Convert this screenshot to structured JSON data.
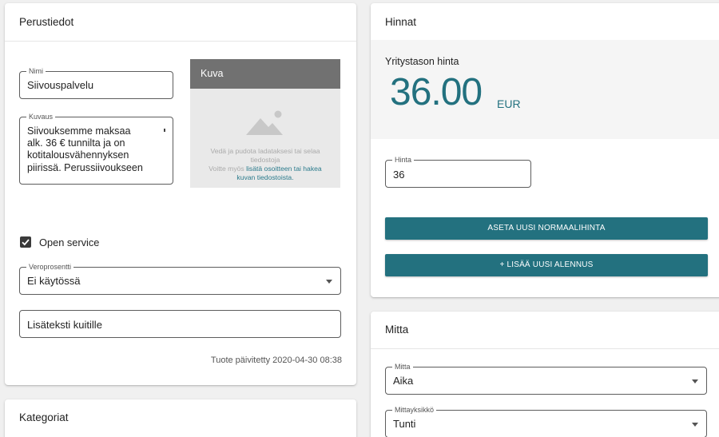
{
  "perustiedot": {
    "title": "Perustiedot",
    "name_legend": "Nimi",
    "name_value": "Siivouspalvelu",
    "description_legend": "Kuvaus",
    "description_lines": [
      "Siivouksemme maksaa",
      "alk. 36 € tunnilta ja on",
      "kotitalousvähennyksen",
      "piirissä. Perussiivoukseen"
    ],
    "image": {
      "title": "Kuva",
      "icon": "image-placeholder-icon",
      "hint_line1": "Vedä ja pudota ladataksesi tai selaa",
      "hint_line2": "tiedostoja",
      "hint_prefix": "Voitte myös ",
      "hint_link1": "lisätä osoitteen tai hakea",
      "hint_link2": "kuvan tiedostoista."
    },
    "open_service_label": "Open service",
    "open_service_checked": true,
    "vat_legend": "Veroprosentti",
    "vat_value": "Ei käytössä",
    "receipt_text_placeholder": "Lisäteksti kuitille",
    "updated_text": "Tuote päivitetty 2020-04-30 08:38"
  },
  "kategoriat": {
    "title": "Kategoriat"
  },
  "hinnat": {
    "title": "Hinnat",
    "company_price_label": "Yritystason hinta",
    "price": "36.00",
    "currency": "EUR",
    "price_legend": "Hinta",
    "price_value": "36",
    "set_price_button": "ASETA UUSI NORMAALIHINTA",
    "add_discount_button": "+ LISÄÄ UUSI ALENNUS"
  },
  "mitta": {
    "title": "Mitta",
    "measure_legend": "Mitta",
    "measure_value": "Aika",
    "unit_legend": "Mittayksikkö",
    "unit_value": "Tunti"
  },
  "colors": {
    "accent": "#23717f",
    "image_header": "#717171"
  }
}
